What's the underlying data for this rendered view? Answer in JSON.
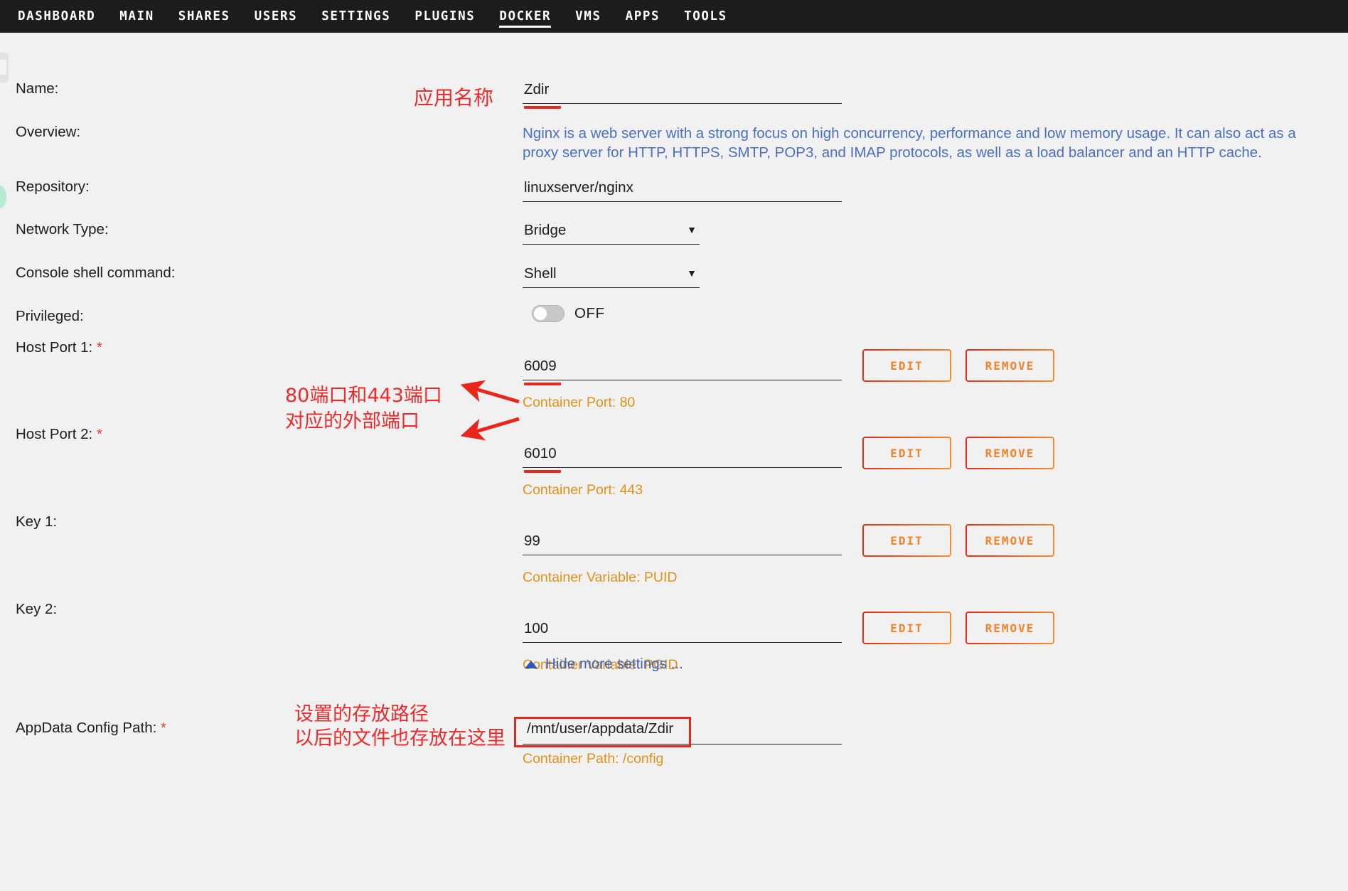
{
  "nav": {
    "items": [
      {
        "label": "DASHBOARD",
        "active": false
      },
      {
        "label": "MAIN",
        "active": false
      },
      {
        "label": "SHARES",
        "active": false
      },
      {
        "label": "USERS",
        "active": false
      },
      {
        "label": "SETTINGS",
        "active": false
      },
      {
        "label": "PLUGINS",
        "active": false
      },
      {
        "label": "DOCKER",
        "active": true
      },
      {
        "label": "VMS",
        "active": false
      },
      {
        "label": "APPS",
        "active": false
      },
      {
        "label": "TOOLS",
        "active": false
      }
    ]
  },
  "form": {
    "name": {
      "label": "Name:",
      "value": "Zdir"
    },
    "overview": {
      "label": "Overview:",
      "line1": "Nginx is a web server with a strong focus on high concurrency, performance and low memory usage. It can also act as a",
      "line2": "proxy server for HTTP, HTTPS, SMTP, POP3, and IMAP protocols, as well as a load balancer and an HTTP cache."
    },
    "repository": {
      "label": "Repository:",
      "value": "linuxserver/nginx"
    },
    "network_type": {
      "label": "Network Type:",
      "value": "Bridge"
    },
    "console_shell": {
      "label": "Console shell command:",
      "value": "Shell"
    },
    "privileged": {
      "label": "Privileged:",
      "state": "OFF"
    },
    "host_port_1": {
      "label": "Host Port 1:",
      "required": "*",
      "value": "6009",
      "hint": "Container Port: 80"
    },
    "host_port_2": {
      "label": "Host Port 2:",
      "required": "*",
      "value": "6010",
      "hint": "Container Port: 443"
    },
    "key_1": {
      "label": "Key 1:",
      "value": "99",
      "hint": "Container Variable: PUID"
    },
    "key_2": {
      "label": "Key 2:",
      "value": "100",
      "hint": "Container Variable: PGID"
    },
    "appdata": {
      "label": "AppData Config Path:",
      "required": "*",
      "value": "/mnt/user/appdata/Zdir",
      "hint": "Container Path: /config"
    },
    "more_settings_link": "Hide more settings ...",
    "buttons": {
      "edit": "EDIT",
      "remove": "REMOVE"
    }
  },
  "annotations": {
    "name_note": "应用名称",
    "ports_note_line1": "80端口和443端口",
    "ports_note_line2": "对应的外部端口",
    "path_note_line1": "设置的存放路径",
    "path_note_line2": "以后的文件也存放在这里"
  },
  "colors": {
    "nav_bg": "#1c1c1c",
    "page_bg": "#f1f1f1",
    "accent_orange": "#f5822a",
    "hint_orange": "#e09119",
    "link_blue": "#3b63c0",
    "overview_blue": "#4a6fc3",
    "annotation_red": "#ed2a2a",
    "required_red": "#e23e2a"
  }
}
